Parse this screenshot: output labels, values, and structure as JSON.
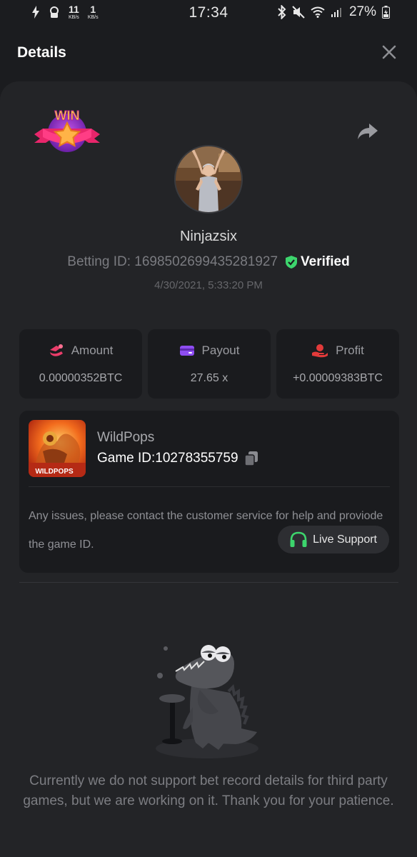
{
  "status_bar": {
    "net_down_value": "11",
    "net_down_unit": "KB/s",
    "net_up_value": "1",
    "net_up_unit": "KB/s",
    "time": "17:34",
    "battery": "27%"
  },
  "header": {
    "title": "Details"
  },
  "badge": {
    "label": "WIN"
  },
  "player": {
    "username": "Ninjazsix",
    "betting_id_label": "Betting ID: 1698502699435281927",
    "verified_label": "Verified",
    "datetime": "4/30/2021, 5:33:20 PM"
  },
  "stats": [
    {
      "label": "Amount",
      "value": "0.00000352BTC",
      "icon": "amount-icon",
      "color": "#ea3d6a"
    },
    {
      "label": "Payout",
      "value": "27.65 x",
      "icon": "payout-card-icon",
      "color": "#8e4df2"
    },
    {
      "label": "Profit",
      "value": "+0.00009383BTC",
      "icon": "profit-hand-icon",
      "color": "#e23a3a"
    }
  ],
  "game": {
    "name": "WildPops",
    "id_label": "Game ID:10278355759",
    "thumb_text": "WILDPOPS",
    "help_text": "Any issues, please contact the customer service for help and proviode the game ID.",
    "support_label": "Live Support"
  },
  "empty_state": {
    "message": "Currently we do not support bet record details for third party games, but we are working on it. Thank you for your patience."
  },
  "colors": {
    "background": "#1b1c1f",
    "sheet": "#232427",
    "card": "#1a1b1e",
    "verified_green": "#3dd56d",
    "support_green": "#3dd56d"
  }
}
